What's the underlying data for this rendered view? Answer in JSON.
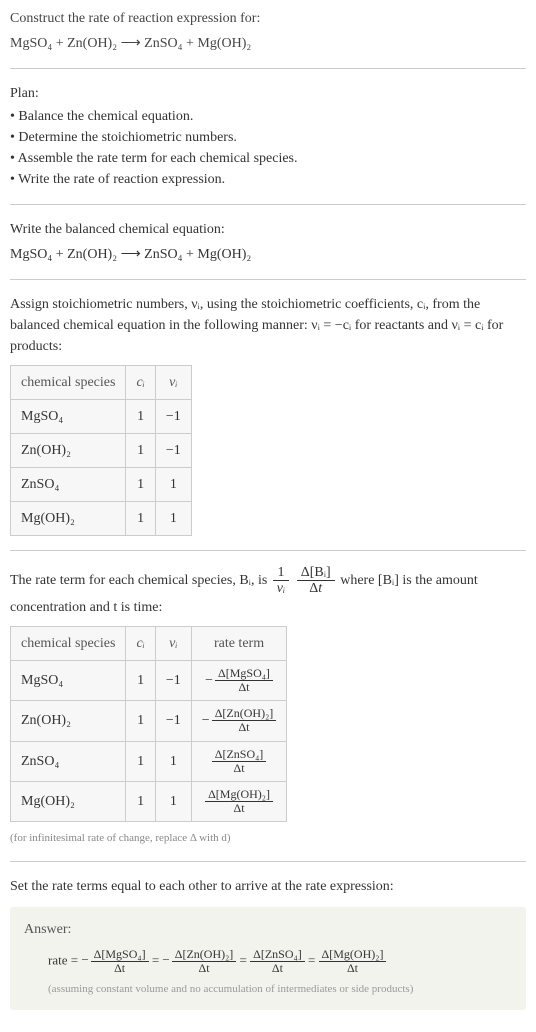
{
  "prompt": {
    "line1": "Construct the rate of reaction expression for:",
    "equation": "MgSO₄ + Zn(OH)₂ ⟶ ZnSO₄ + Mg(OH)₂"
  },
  "plan": {
    "header": "Plan:",
    "items": [
      "• Balance the chemical equation.",
      "• Determine the stoichiometric numbers.",
      "• Assemble the rate term for each chemical species.",
      "• Write the rate of reaction expression."
    ]
  },
  "balanced": {
    "intro": "Write the balanced chemical equation:",
    "equation": "MgSO₄ + Zn(OH)₂ ⟶ ZnSO₄ + Mg(OH)₂"
  },
  "stoich_text": "Assign stoichiometric numbers, νᵢ, using the stoichiometric coefficients, cᵢ, from the balanced chemical equation in the following manner: νᵢ = −cᵢ for reactants and νᵢ = cᵢ for products:",
  "table1": {
    "headers": [
      "chemical species",
      "cᵢ",
      "νᵢ"
    ],
    "rows": [
      [
        "MgSO₄",
        "1",
        "−1"
      ],
      [
        "Zn(OH)₂",
        "1",
        "−1"
      ],
      [
        "ZnSO₄",
        "1",
        "1"
      ],
      [
        "Mg(OH)₂",
        "1",
        "1"
      ]
    ]
  },
  "rate_term_text_pre": "The rate term for each chemical species, Bᵢ, is ",
  "rate_term_text_post": " where [Bᵢ] is the amount concentration and t is time:",
  "table2": {
    "headers": [
      "chemical species",
      "cᵢ",
      "νᵢ",
      "rate term"
    ],
    "rows": [
      {
        "species": "MgSO₄",
        "c": "1",
        "v": "−1",
        "neg": true,
        "delta": "Δ[MgSO₄]"
      },
      {
        "species": "Zn(OH)₂",
        "c": "1",
        "v": "−1",
        "neg": true,
        "delta": "Δ[Zn(OH)₂]"
      },
      {
        "species": "ZnSO₄",
        "c": "1",
        "v": "1",
        "neg": false,
        "delta": "Δ[ZnSO₄]"
      },
      {
        "species": "Mg(OH)₂",
        "c": "1",
        "v": "1",
        "neg": false,
        "delta": "Δ[Mg(OH)₂]"
      }
    ]
  },
  "dt": "Δt",
  "table2_note": "(for infinitesimal rate of change, replace Δ with d)",
  "set_equal": "Set the rate terms equal to each other to arrive at the rate expression:",
  "answer": {
    "label": "Answer:",
    "rate_prefix": "rate = ",
    "terms": [
      {
        "neg": true,
        "delta": "Δ[MgSO₄]"
      },
      {
        "neg": true,
        "delta": "Δ[Zn(OH)₂]"
      },
      {
        "neg": false,
        "delta": "Δ[ZnSO₄]"
      },
      {
        "neg": false,
        "delta": "Δ[Mg(OH)₂]"
      }
    ],
    "note": "(assuming constant volume and no accumulation of intermediates or side products)"
  },
  "chart_data": {
    "type": "table",
    "tables": [
      {
        "title": "stoichiometric numbers",
        "columns": [
          "chemical species",
          "c_i",
          "ν_i"
        ],
        "rows": [
          [
            "MgSO4",
            1,
            -1
          ],
          [
            "Zn(OH)2",
            1,
            -1
          ],
          [
            "ZnSO4",
            1,
            1
          ],
          [
            "Mg(OH)2",
            1,
            1
          ]
        ]
      },
      {
        "title": "rate terms",
        "columns": [
          "chemical species",
          "c_i",
          "ν_i",
          "rate term"
        ],
        "rows": [
          [
            "MgSO4",
            1,
            -1,
            "-Δ[MgSO4]/Δt"
          ],
          [
            "Zn(OH)2",
            1,
            -1,
            "-Δ[Zn(OH)2]/Δt"
          ],
          [
            "ZnSO4",
            1,
            1,
            "Δ[ZnSO4]/Δt"
          ],
          [
            "Mg(OH)2",
            1,
            1,
            "Δ[Mg(OH)2]/Δt"
          ]
        ]
      }
    ]
  }
}
